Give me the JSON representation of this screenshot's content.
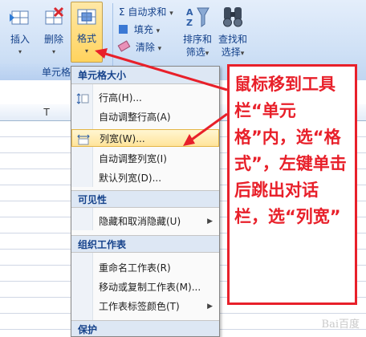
{
  "ribbon": {
    "insert_label": "插入",
    "delete_label": "删除",
    "format_label": "格式",
    "group_label": "单元格",
    "autosum_label": "Σ 自动求和",
    "fill_label": "填充",
    "clear_label": "清除",
    "sort_label_1": "排序和",
    "sort_label_2": "筛选",
    "find_label_1": "查找和",
    "find_label_2": "选择",
    "dropdown_arrow": "▾"
  },
  "sheet": {
    "column_T": "T"
  },
  "menu": {
    "section_cell_size": "单元格大小",
    "row_height": "行高(H)...",
    "autofit_row": "自动调整行高(A)",
    "column_width": "列宽(W)...",
    "autofit_column": "自动调整列宽(I)",
    "default_width": "默认列宽(D)...",
    "section_visibility": "可见性",
    "hide_unhide": "隐藏和取消隐藏(U)",
    "section_organize": "组织工作表",
    "rename_sheet": "重命名工作表(R)",
    "move_copy_sheet": "移动或复制工作表(M)...",
    "tab_color": "工作表标签颜色(T)",
    "section_protect": "保护",
    "submenu_arrow": "▶"
  },
  "annotation": {
    "text": "鼠标移到工具栏“单元格”内，选“格式”，左键单击后跳出对话栏，选“列宽”",
    "color": "#e8202a"
  },
  "watermark": "Bai百度"
}
